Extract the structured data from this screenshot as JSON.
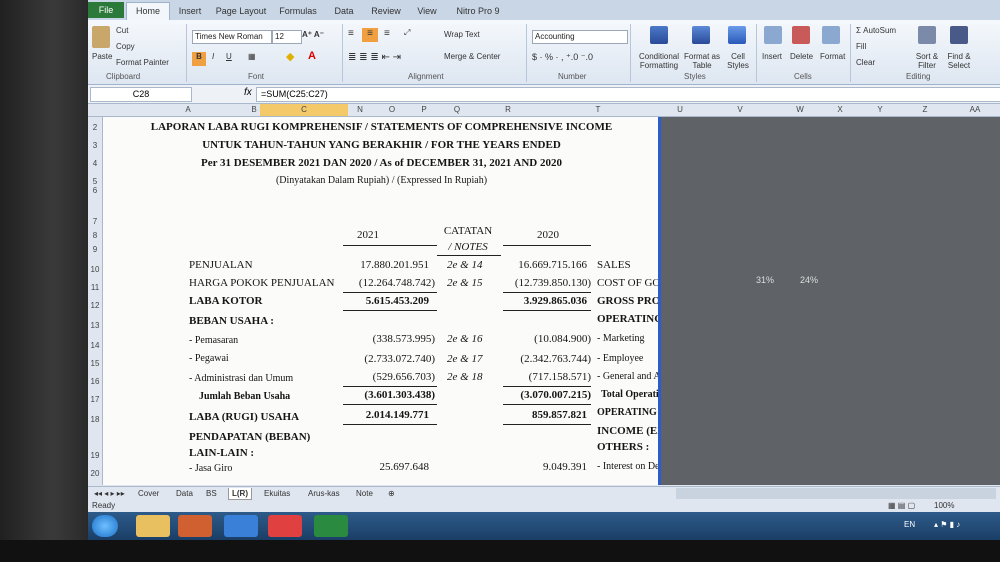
{
  "ribbon": {
    "tabs": [
      "File",
      "Home",
      "Insert",
      "Page Layout",
      "Formulas",
      "Data",
      "Review",
      "View",
      "Nitro Pro 9"
    ],
    "clipboard": {
      "paste": "Paste",
      "cut": "Cut",
      "copy": "Copy",
      "format_painter": "Format Painter",
      "label": "Clipboard"
    },
    "font": {
      "name": "Times New Roman",
      "size": "12",
      "label": "Font"
    },
    "alignment": {
      "wrap": "Wrap Text",
      "merge": "Merge & Center",
      "label": "Alignment"
    },
    "number": {
      "format": "Accounting",
      "label": "Number"
    },
    "styles": {
      "conditional": "Conditional Formatting",
      "format_table": "Format as Table",
      "cell_styles": "Cell Styles",
      "label": "Styles"
    },
    "cells": {
      "insert": "Insert",
      "delete": "Delete",
      "format": "Format",
      "label": "Cells"
    },
    "editing": {
      "autosum": "AutoSum",
      "fill": "Fill",
      "clear": "Clear",
      "sort": "Sort & Filter",
      "find": "Find & Select",
      "label": "Editing"
    }
  },
  "formula_bar": {
    "cell": "C28",
    "fx": "fx",
    "formula": "=SUM(C25:C27)"
  },
  "columns": [
    "A",
    "B",
    "C",
    "N",
    "O",
    "P",
    "Q",
    "R",
    "T",
    "U",
    "V",
    "W",
    "X",
    "Y",
    "Z",
    "AA"
  ],
  "rows": [
    "2",
    "3",
    "4",
    "5",
    "6",
    "7",
    "8",
    "9",
    "10",
    "11",
    "12",
    "13",
    "14",
    "15",
    "16",
    "17",
    "18",
    "19",
    "20"
  ],
  "report": {
    "title1": "LAPORAN LABA RUGI KOMPREHENSIF / STATEMENTS OF COMPREHENSIVE INCOME",
    "title2": "UNTUK TAHUN-TAHUN YANG BERAKHIR / FOR THE YEARS ENDED",
    "title3": "Per 31 DESEMBER 2021 DAN 2020 / As of DECEMBER 31, 2021 AND 2020",
    "title4": "(Dinyatakan Dalam Rupiah) / (Expressed In Rupiah)",
    "hdr_catatan": "CATATAN",
    "hdr_notes": "/ NOTES",
    "hdr_2021": "2021",
    "hdr_2020": "2020",
    "lines": [
      {
        "id": "r10",
        "id_label": "PENJUALAN",
        "v2021": "17.880.201.951",
        "note": "2e & 14",
        "v2020": "16.669.715.166",
        "en": "SALES"
      },
      {
        "id": "r11",
        "id_label": "HARGA POKOK PENJUALAN",
        "v2021": "(12.264.748.742)",
        "note": "2e & 15",
        "v2020": "(12.739.850.130)",
        "en": "COST OF GOOD SOLD"
      },
      {
        "id": "r12",
        "id_label": "LABA KOTOR",
        "v2021": "5.615.453.209",
        "note": "",
        "v2020": "3.929.865.036",
        "en": "GROSS PROFIT"
      },
      {
        "id": "r13",
        "id_label": "BEBAN USAHA :",
        "v2021": "",
        "note": "",
        "v2020": "",
        "en": "OPERATING EXPENSES :"
      },
      {
        "id": "r14",
        "id_label": "- Pemasaran",
        "v2021": "(338.573.995)",
        "note": "2e & 16",
        "v2020": "(10.084.900)",
        "en": "- Marketing"
      },
      {
        "id": "r15",
        "id_label": "- Pegawai",
        "v2021": "(2.733.072.740)",
        "note": "2e & 17",
        "v2020": "(2.342.763.744)",
        "en": "- Employee"
      },
      {
        "id": "r16",
        "id_label": "- Administrasi dan Umum",
        "v2021": "(529.656.703)",
        "note": "2e & 18",
        "v2020": "(717.158.571)",
        "en": "- General and Administration"
      },
      {
        "id": "r17",
        "id_label": "Jumlah Beban Usaha",
        "v2021": "(3.601.303.438)",
        "note": "",
        "v2020": "(3.070.007.215)",
        "en": "Total Operating Expenses"
      },
      {
        "id": "r18",
        "id_label": "LABA (RUGI) USAHA",
        "v2021": "2.014.149.771",
        "note": "",
        "v2020": "859.857.821",
        "en": "OPERATING PROFIT (LOSS)"
      },
      {
        "id": "r19",
        "id_label": "PENDAPATAN (BEBAN) LAIN-LAIN :",
        "v2021": "",
        "note": "",
        "v2020": "",
        "en": "INCOME (EXPENSE) OTHERS :"
      },
      {
        "id": "r20",
        "id_label": "- Jasa Giro",
        "v2021": "25.697.648",
        "note": "",
        "v2020": "9.049.391",
        "en": "- Interest on Demand Deposit"
      }
    ],
    "side_pct1": "31%",
    "side_pct2": "24%"
  },
  "sheet_tabs": [
    "Cover",
    "Data",
    "BS",
    "L(R)",
    "Ekuitas",
    "Arus-kas",
    "Note"
  ],
  "active_sheet": "L(R)",
  "status": {
    "ready": "Ready",
    "zoom": "100%",
    "lang": "EN"
  }
}
